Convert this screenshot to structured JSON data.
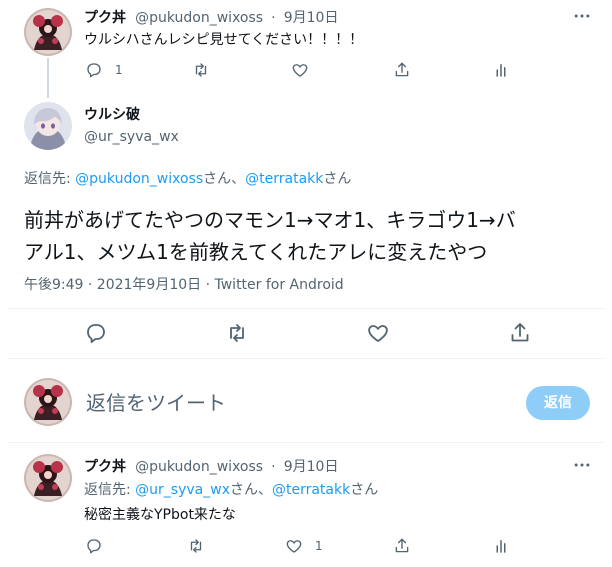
{
  "tweet1": {
    "name": "プク丼",
    "handle": "@pukudon_wixoss",
    "sep": "·",
    "date": "9月10日",
    "text": "ウルシハさんレシピ見せてください！！！！",
    "reply_count": "1"
  },
  "main": {
    "name": "ウルシ破",
    "handle": "@ur_syva_wx",
    "reply_prefix": "返信先: ",
    "reply_to_1": "@pukudon_wixoss",
    "reply_san_1": "さん、",
    "reply_to_2": "@terratakk",
    "reply_san_2": "さん",
    "text_line1": "前丼があげてたやつのマモン1→マオ1、キラゴウ1→バ",
    "text_line2": "アル1、メツム1を前教えてくれたアレに変えたやつ",
    "timestamp": "午後9:49 · 2021年9月10日 · Twitter for Android"
  },
  "compose": {
    "placeholder": "返信をツイート",
    "button_label": "返信"
  },
  "tweet3": {
    "name": "プク丼",
    "handle": "@pukudon_wixoss",
    "sep": "·",
    "date": "9月10日",
    "reply_prefix": "返信先: ",
    "reply_to_1": "@ur_syva_wx",
    "reply_san_1": "さん、",
    "reply_to_2": "@terratakk",
    "reply_san_2": "さん",
    "text": "秘密主義なYPbot来たな",
    "like_count": "1"
  },
  "colors": {
    "accent": "#1d9bf0",
    "reply_button": "#8ecdf8",
    "muted_text": "#536471"
  },
  "icons": [
    "more-icon",
    "reply-icon",
    "retweet-icon",
    "like-icon",
    "share-icon",
    "analytics-icon"
  ]
}
